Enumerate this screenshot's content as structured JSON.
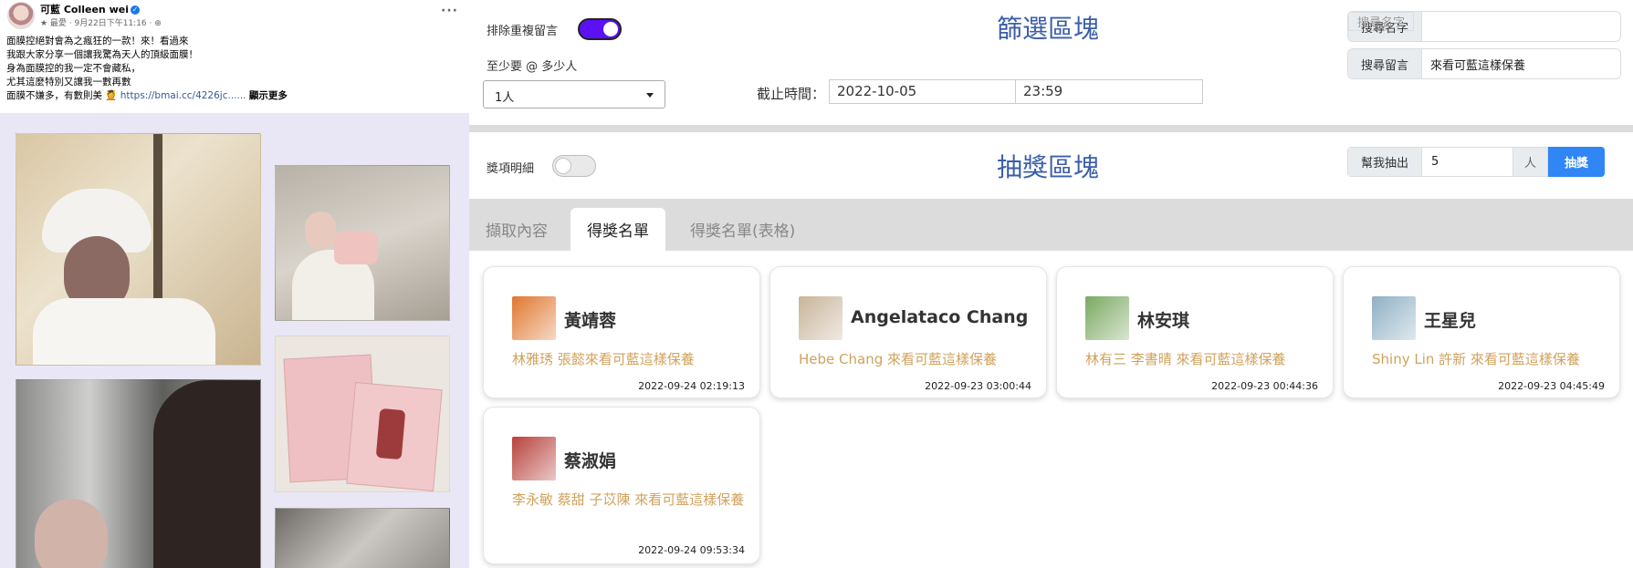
{
  "post": {
    "author": "可藍 Colleen wei",
    "meta": "★ 最愛 · 9月22日下午11:16 · ⊕",
    "more": "···",
    "lines": [
      "面膜控絕對會為之瘋狂的一款！來！看過來",
      "我跟大家分享一個讓我驚為天人的頂級面膜！",
      "身為面膜控的我一定不會藏私，",
      "尤其這麼特別又讓我一數再數",
      "面膜不嫌多，有數則美 💆"
    ],
    "link": "https://bmai.cc/4226jc......",
    "see_more": "顯示更多"
  },
  "filter": {
    "title": "篩選區塊",
    "dedupe_label": "排除重複留言",
    "min_tag_label": "至少要 @ 多少人",
    "min_tag_value": "1人",
    "deadline_label": "截止時間：",
    "deadline_date": "2022-10-05",
    "deadline_time": "23:59",
    "search_name_label": "搜尋名字",
    "search_name_placeholder": "搜尋名字",
    "search_comment_label": "搜尋留言",
    "search_comment_value": "來看可藍這樣保養"
  },
  "draw": {
    "title": "抽獎區塊",
    "detail_label": "獎項明細",
    "draw_for_me_label": "幫我抽出",
    "count": "5",
    "unit": "人",
    "button": "抽獎"
  },
  "tabs": [
    "擷取內容",
    "得獎名單",
    "得獎名單(表格)"
  ],
  "winners": [
    {
      "name": "黃靖蓉",
      "comment": "林雅琇 張懿來看可藍這樣保養",
      "time": "2022-09-24 02:19:13",
      "avatar": "#e0772f"
    },
    {
      "name": "Angelataco Chang",
      "comment": "Hebe Chang 來看可藍這樣保養",
      "time": "2022-09-23 03:00:44",
      "avatar": "#c9b49a"
    },
    {
      "name": "林安琪",
      "comment": "林有三 李書晴 來看可藍這樣保養",
      "time": "2022-09-23 00:44:36",
      "avatar": "#7aa860"
    },
    {
      "name": "王星兒",
      "comment": "Shiny Lin 許新 來看可藍這樣保養",
      "time": "2022-09-23 04:45:49",
      "avatar": "#8fb0c4"
    },
    {
      "name": "蔡淑娟",
      "comment": "李永敏 蔡甜 子苡陳 來看可藍這樣保養",
      "time": "2022-09-24 09:53:34",
      "avatar": "#b8413b"
    }
  ]
}
